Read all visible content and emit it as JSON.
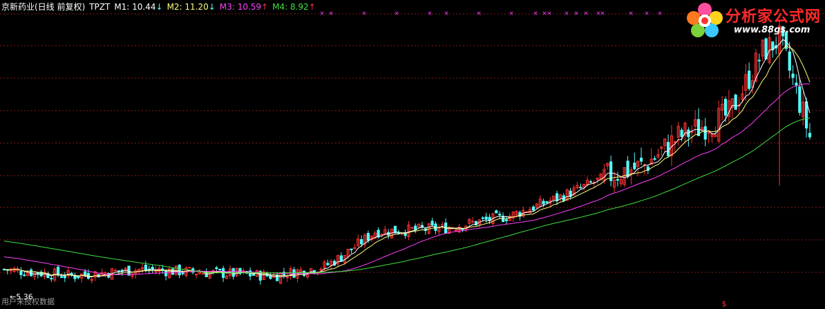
{
  "header": {
    "title": "京新药业(日线 前复权)",
    "indicator": "TPZT",
    "m1_label": "M1: 10.44",
    "m1_arrow": "↓",
    "m2_label": "M2: 11.20",
    "m2_arrow": "↓",
    "m3_label": "M3: 10.59",
    "m3_arrow": "↑",
    "m4_label": "M4: 8.92",
    "m4_arrow": "↑"
  },
  "colors": {
    "up": "#ff3232",
    "down": "#54ffff",
    "m1": "#ffffff",
    "m2": "#ffff80",
    "m3": "#ff40ff",
    "m4": "#40e040",
    "grid": "#8a1a1a",
    "marker": "#ff40ff"
  },
  "watermark": {
    "title": "分析家公式网",
    "url": "www.88gs.com",
    "icon": "flower-logo-icon"
  },
  "footer": {
    "text": "用户未授权数据",
    "low_label": "5.36"
  },
  "chart_data": {
    "type": "candlestick",
    "title": "京新药业(日线 前复权)",
    "ylim": [
      5.0,
      14.2
    ],
    "grid": true,
    "low_value": 5.36,
    "dollar_marker": "$",
    "latest": {
      "M1": 10.44,
      "M2": 11.2,
      "M3": 10.59,
      "M4": 8.92
    }
  }
}
